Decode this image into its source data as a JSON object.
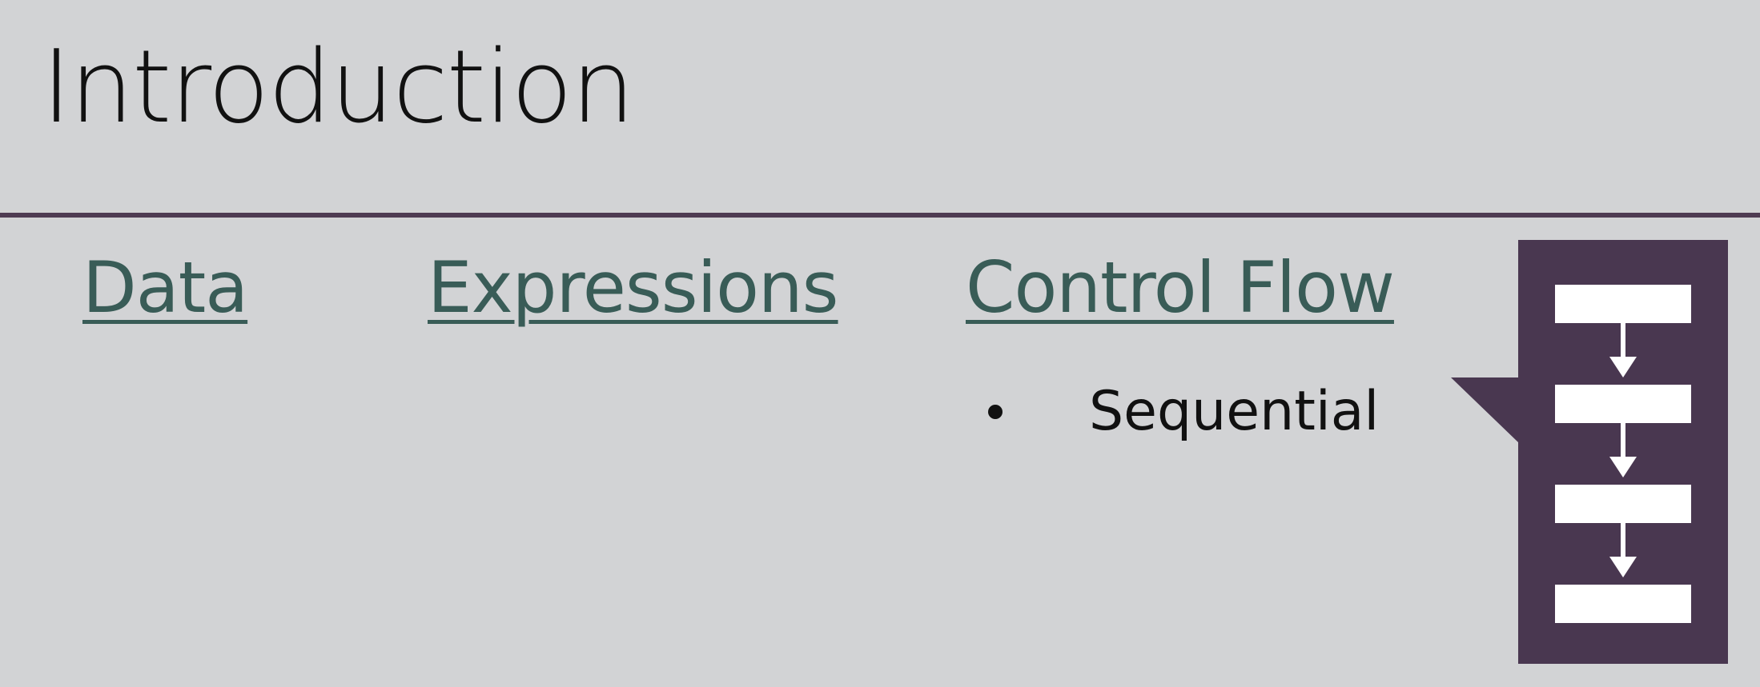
{
  "slide": {
    "title": "Introduction",
    "topics": [
      {
        "label": "Data"
      },
      {
        "label": "Expressions"
      },
      {
        "label": "Control Flow"
      }
    ],
    "bullets": [
      {
        "text": "Sequential"
      }
    ]
  },
  "graphic": {
    "icon": "sequential-flow-icon",
    "background_color": "#493750",
    "box_color": "#ffffff"
  },
  "colors": {
    "background": "#d2d3d5",
    "divider": "#4e3b52",
    "link": "#395c57",
    "text": "#111111"
  }
}
